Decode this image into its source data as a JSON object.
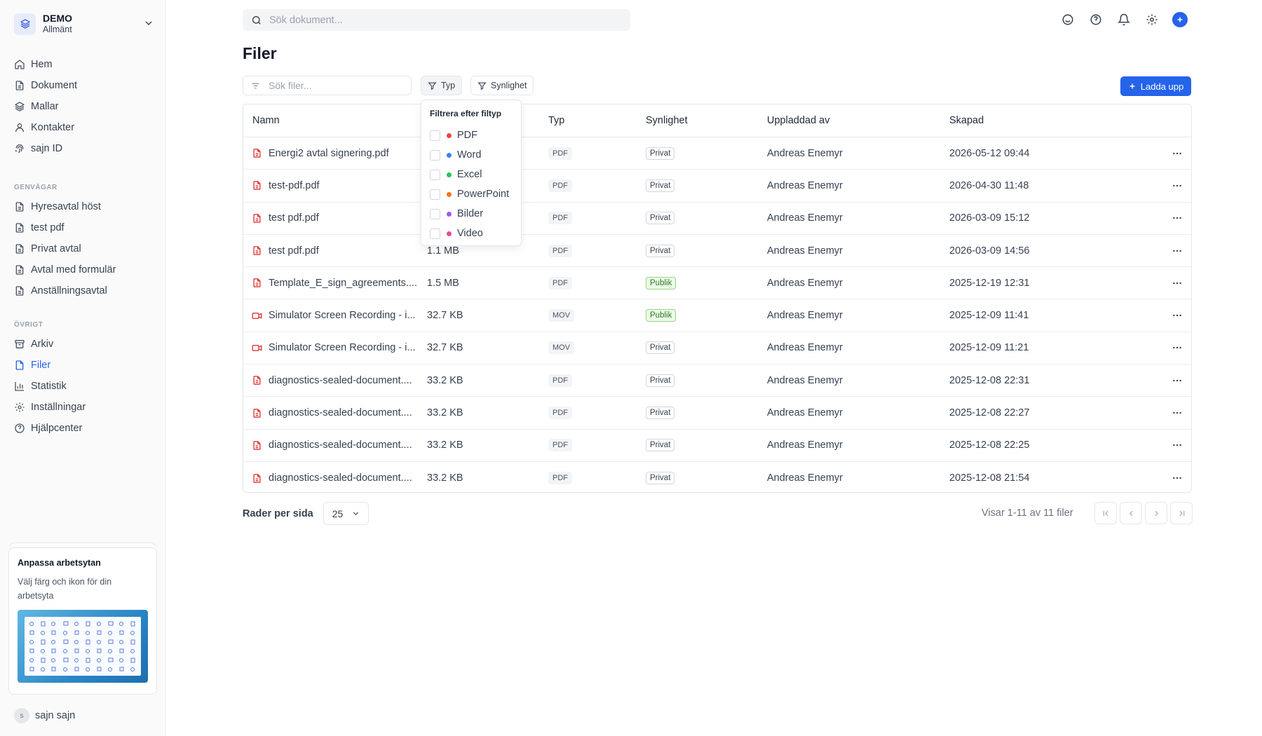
{
  "workspace": {
    "name": "DEMO",
    "sub": "Allmänt"
  },
  "nav_main": [
    {
      "label": "Hem",
      "icon": "home-icon"
    },
    {
      "label": "Dokument",
      "icon": "document-icon"
    },
    {
      "label": "Mallar",
      "icon": "layers-icon"
    },
    {
      "label": "Kontakter",
      "icon": "user-icon"
    },
    {
      "label": "sajn ID",
      "icon": "fingerprint-icon"
    }
  ],
  "shortcuts_title": "GENVÄGAR",
  "shortcuts": [
    {
      "label": "Hyresavtal höst"
    },
    {
      "label": "test pdf"
    },
    {
      "label": "Privat avtal"
    },
    {
      "label": "Avtal med formulär"
    },
    {
      "label": "Anställningsavtal"
    }
  ],
  "other_title": "ÖVRIGT",
  "other": [
    {
      "label": "Arkiv",
      "icon": "archive-icon"
    },
    {
      "label": "Filer",
      "icon": "file-icon",
      "active": true
    },
    {
      "label": "Statistik",
      "icon": "chart-icon"
    },
    {
      "label": "Inställningar",
      "icon": "gear-icon"
    },
    {
      "label": "Hjälpcenter",
      "icon": "help-icon"
    }
  ],
  "promo": {
    "title": "Anpassa arbetsytan",
    "desc": "Välj färg och ikon för din arbetsyta"
  },
  "user": {
    "initial": "s",
    "name": "sajn sajn"
  },
  "search": {
    "placeholder": "Sök dokument..."
  },
  "page": {
    "title": "Filer"
  },
  "filter": {
    "placeholder": "Sök filer...",
    "type_label": "Typ",
    "visibility_label": "Synlighet",
    "upload_label": "Ladda upp"
  },
  "dropdown": {
    "title": "Filtrera efter filtyp",
    "options": [
      {
        "label": "PDF",
        "color": "#ef4444"
      },
      {
        "label": "Word",
        "color": "#3b82f6"
      },
      {
        "label": "Excel",
        "color": "#22c55e"
      },
      {
        "label": "PowerPoint",
        "color": "#f97316"
      },
      {
        "label": "Bilder",
        "color": "#a855f7"
      },
      {
        "label": "Video",
        "color": "#ec4899"
      }
    ]
  },
  "table": {
    "headers": {
      "name": "Namn",
      "size": "",
      "type": "Typ",
      "visibility": "Synlighet",
      "uploaded_by": "Uppladdad av",
      "created": "Skapad"
    },
    "rows": [
      {
        "name": "Energi2 avtal signering.pdf",
        "size": "",
        "type": "PDF",
        "visibility": "Privat",
        "uploaded_by": "Andreas Enemyr",
        "created": "2026-05-12 09:44",
        "icon": "pdf-file-icon"
      },
      {
        "name": "test-pdf.pdf",
        "size": "",
        "type": "PDF",
        "visibility": "Privat",
        "uploaded_by": "Andreas Enemyr",
        "created": "2026-04-30 11:48",
        "icon": "pdf-file-icon"
      },
      {
        "name": "test pdf.pdf",
        "size": "",
        "type": "PDF",
        "visibility": "Privat",
        "uploaded_by": "Andreas Enemyr",
        "created": "2026-03-09 15:12",
        "icon": "pdf-file-icon"
      },
      {
        "name": "test pdf.pdf",
        "size": "1.1 MB",
        "type": "PDF",
        "visibility": "Privat",
        "uploaded_by": "Andreas Enemyr",
        "created": "2026-03-09 14:56",
        "icon": "pdf-file-icon"
      },
      {
        "name": "Template_E_sign_agreements....",
        "size": "1.5 MB",
        "type": "PDF",
        "visibility": "Publik",
        "uploaded_by": "Andreas Enemyr",
        "created": "2025-12-19 12:31",
        "icon": "pdf-file-icon"
      },
      {
        "name": "Simulator Screen Recording - i...",
        "size": "32.7 KB",
        "type": "MOV",
        "visibility": "Publik",
        "uploaded_by": "Andreas Enemyr",
        "created": "2025-12-09 11:41",
        "icon": "video-file-icon"
      },
      {
        "name": "Simulator Screen Recording - i...",
        "size": "32.7 KB",
        "type": "MOV",
        "visibility": "Privat",
        "uploaded_by": "Andreas Enemyr",
        "created": "2025-12-09 11:21",
        "icon": "video-file-icon"
      },
      {
        "name": "diagnostics-sealed-document....",
        "size": "33.2 KB",
        "type": "PDF",
        "visibility": "Privat",
        "uploaded_by": "Andreas Enemyr",
        "created": "2025-12-08 22:31",
        "icon": "pdf-file-icon"
      },
      {
        "name": "diagnostics-sealed-document....",
        "size": "33.2 KB",
        "type": "PDF",
        "visibility": "Privat",
        "uploaded_by": "Andreas Enemyr",
        "created": "2025-12-08 22:27",
        "icon": "pdf-file-icon"
      },
      {
        "name": "diagnostics-sealed-document....",
        "size": "33.2 KB",
        "type": "PDF",
        "visibility": "Privat",
        "uploaded_by": "Andreas Enemyr",
        "created": "2025-12-08 22:25",
        "icon": "pdf-file-icon"
      },
      {
        "name": "diagnostics-sealed-document....",
        "size": "33.2 KB",
        "type": "PDF",
        "visibility": "Privat",
        "uploaded_by": "Andreas Enemyr",
        "created": "2025-12-08 21:54",
        "icon": "pdf-file-icon"
      }
    ]
  },
  "pagination": {
    "rows_label": "Rader per sida",
    "rows_value": "25",
    "showing": "Visar 1-11 av 11 filer"
  },
  "colors": {
    "accent": "#2563eb",
    "pdf": "#dc2626",
    "public_badge": "#2f7a26"
  }
}
